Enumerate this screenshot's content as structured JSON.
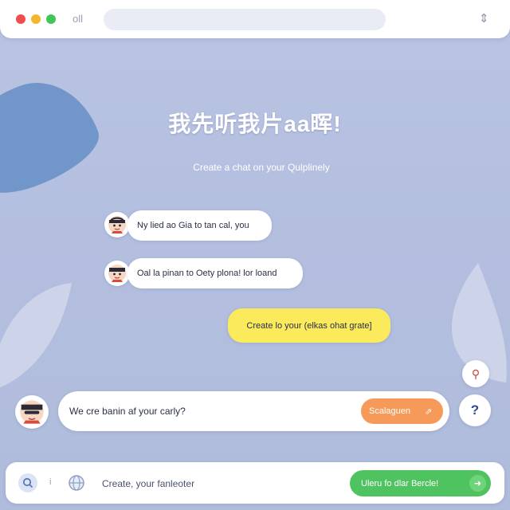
{
  "window": {
    "controls": [
      "close",
      "minimize",
      "maximize"
    ],
    "label": "oll",
    "menu_icon": "sliders-icon",
    "menu_glyph": "⇕"
  },
  "hero": {
    "title": "我先听我片aa晖!",
    "subtitle": "Create a chat on your Qulplinely"
  },
  "messages": [
    {
      "from": "bot",
      "text": "Ny lied ao Gia to tan cal, you",
      "avatar_icon": "avatar-icon"
    },
    {
      "from": "bot",
      "text": "Oal la pinan to Oety plona! lor loand",
      "avatar_icon": "avatar-icon"
    },
    {
      "from": "user",
      "text": "Create lo your (elkas ohat grate]"
    }
  ],
  "side_buttons": {
    "top": {
      "icon": "pin-icon",
      "glyph": "⚲"
    },
    "bottom": {
      "icon": "help-icon",
      "glyph": "?"
    }
  },
  "composer": {
    "value": "We cre banin af your carly?",
    "action_label": "Scalaguen",
    "action_icon": "share-icon",
    "action_glyph": "⇗"
  },
  "bottom_bar": {
    "separator": "i",
    "input_placeholder": "Create, your fanleoter",
    "primary_label": "Uleru fo dlar Bercle!",
    "primary_icon": "arrow-icon",
    "primary_glyph": "➜"
  },
  "colors": {
    "background": "#b6c1df",
    "accent_blue": "#6e94c8",
    "yellow_bubble": "#fbea5c",
    "orange_button": "#f59a58",
    "green_button": "#4fc35f"
  }
}
